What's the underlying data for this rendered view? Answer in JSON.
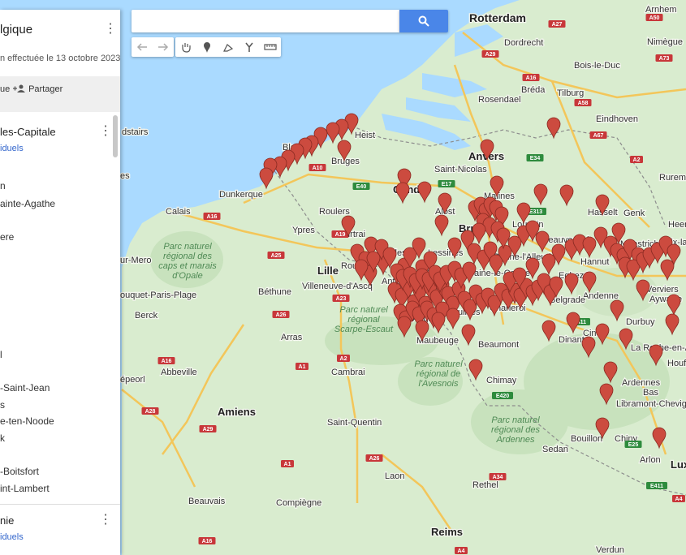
{
  "map": {
    "sea_color": "#aadaff",
    "land_color": "#d7ecd0",
    "pin_color": "#cc4b3f",
    "cities": [
      {
        "id": "rotterdam",
        "label": "Rotterdam",
        "cls": "big"
      },
      {
        "id": "arnhem",
        "label": "Arnhem",
        "cls": ""
      },
      {
        "id": "dordrecht",
        "label": "Dordrecht",
        "cls": ""
      },
      {
        "id": "nimegue",
        "label": "Nimègue",
        "cls": ""
      },
      {
        "id": "boisleduc",
        "label": "Bois-le-Duc",
        "cls": ""
      },
      {
        "id": "breda",
        "label": "Bréda",
        "cls": ""
      },
      {
        "id": "tilburg",
        "label": "Tilburg",
        "cls": ""
      },
      {
        "id": "rosendael",
        "label": "Rosendael",
        "cls": ""
      },
      {
        "id": "eindhoven",
        "label": "Eindhoven",
        "cls": ""
      },
      {
        "id": "heist",
        "label": "Heist",
        "cls": ""
      },
      {
        "id": "blank",
        "label": "Blank",
        "cls": ""
      },
      {
        "id": "bruges",
        "label": "Bruges",
        "cls": ""
      },
      {
        "id": "anvers",
        "label": "Anvers",
        "cls": "med"
      },
      {
        "id": "saintnicolas",
        "label": "Saint-Nicolas",
        "cls": ""
      },
      {
        "id": "gand",
        "label": "Gand",
        "cls": "med"
      },
      {
        "id": "malines",
        "label": "Malines",
        "cls": ""
      },
      {
        "id": "dunkerque",
        "label": "Dunkerque",
        "cls": ""
      },
      {
        "id": "roulers",
        "label": "Roulers",
        "cls": ""
      },
      {
        "id": "hasselt",
        "label": "Hasselt",
        "cls": ""
      },
      {
        "id": "genk",
        "label": "Genk",
        "cls": ""
      },
      {
        "id": "ruremonde",
        "label": "Ruremonde",
        "cls": ""
      },
      {
        "id": "calais",
        "label": "Calais",
        "cls": ""
      },
      {
        "id": "alost",
        "label": "Alost",
        "cls": ""
      },
      {
        "id": "bruxelles",
        "label": "Bru",
        "cls": "med"
      },
      {
        "id": "louvain",
        "label": "Louvain",
        "cls": ""
      },
      {
        "id": "heerlen",
        "label": "Heerl",
        "cls": ""
      },
      {
        "id": "ypres",
        "label": "Ypres",
        "cls": ""
      },
      {
        "id": "courtrai",
        "label": "Courtrai",
        "cls": ""
      },
      {
        "id": "beauvechain",
        "label": "Beauvechain",
        "cls": ""
      },
      {
        "id": "maastricht",
        "label": "Maastricht",
        "cls": ""
      },
      {
        "id": "aixla",
        "label": "Aix-la",
        "cls": ""
      },
      {
        "id": "celles",
        "label": "Celles",
        "cls": ""
      },
      {
        "id": "lessines",
        "label": "Lessines",
        "cls": ""
      },
      {
        "id": "brainealleud",
        "label": "Braine-l'Alleud",
        "cls": ""
      },
      {
        "id": "hannut",
        "label": "Hannut",
        "cls": ""
      },
      {
        "id": "lille",
        "label": "Lille",
        "cls": "med"
      },
      {
        "id": "roubaix",
        "label": "Roub",
        "cls": ""
      },
      {
        "id": "egheze",
        "label": "Eghezée",
        "cls": ""
      },
      {
        "id": "antoing",
        "label": "Antoing",
        "cls": ""
      },
      {
        "id": "arbre",
        "label": "Arbre",
        "cls": ""
      },
      {
        "id": "brainelecomte",
        "label": "Braine-le-Comte",
        "cls": ""
      },
      {
        "id": "villeneuve",
        "label": "Villeneuve-d'Ascq",
        "cls": ""
      },
      {
        "id": "bethune",
        "label": "Béthune",
        "cls": ""
      },
      {
        "id": "andenne",
        "label": "Andenne",
        "cls": ""
      },
      {
        "id": "verviers",
        "label": "Verviers",
        "cls": ""
      },
      {
        "id": "aywaille",
        "label": "Aywaille",
        "cls": ""
      },
      {
        "id": "belgrade",
        "label": "Belgrade",
        "cls": ""
      },
      {
        "id": "asquillies",
        "label": "Asquillies",
        "cls": ""
      },
      {
        "id": "charleroi",
        "label": "Charleroi",
        "cls": ""
      },
      {
        "id": "berck",
        "label": "Berck",
        "cls": ""
      },
      {
        "id": "arras",
        "label": "Arras",
        "cls": ""
      },
      {
        "id": "angre",
        "label": "Angre",
        "cls": ""
      },
      {
        "id": "durbuy",
        "label": "Durbuy",
        "cls": ""
      },
      {
        "id": "maubeuge",
        "label": "Maubeuge",
        "cls": ""
      },
      {
        "id": "beaumont",
        "label": "Beaumont",
        "cls": ""
      },
      {
        "id": "ciney",
        "label": "Ciney",
        "cls": ""
      },
      {
        "id": "dinant",
        "label": "Dinant",
        "cls": ""
      },
      {
        "id": "laroche",
        "label": "La Roche-en-Ardenne",
        "cls": ""
      },
      {
        "id": "houff",
        "label": "Houff",
        "cls": ""
      },
      {
        "id": "abbeville",
        "label": "Abbeville",
        "cls": ""
      },
      {
        "id": "cambrai",
        "label": "Cambrai",
        "cls": ""
      },
      {
        "id": "chimay",
        "label": "Chimay",
        "cls": ""
      },
      {
        "id": "ardennes",
        "label": "Ardennes",
        "cls": ""
      },
      {
        "id": "bastogne",
        "label": "Bas",
        "cls": ""
      },
      {
        "id": "libramont",
        "label": "Libramont-Chevigny",
        "cls": ""
      },
      {
        "id": "amiens",
        "label": "Amiens",
        "cls": "med"
      },
      {
        "id": "saintquentin",
        "label": "Saint-Quentin",
        "cls": ""
      },
      {
        "id": "bouillon",
        "label": "Bouillon",
        "cls": ""
      },
      {
        "id": "chiny",
        "label": "Chiny",
        "cls": ""
      },
      {
        "id": "sedan",
        "label": "Sedan",
        "cls": ""
      },
      {
        "id": "arlon",
        "label": "Arlon",
        "cls": ""
      },
      {
        "id": "lux",
        "label": "Lux",
        "cls": "med"
      },
      {
        "id": "laon",
        "label": "Laon",
        "cls": ""
      },
      {
        "id": "rethel",
        "label": "Rethel",
        "cls": ""
      },
      {
        "id": "beauvais",
        "label": "Beauvais",
        "cls": ""
      },
      {
        "id": "compiegne",
        "label": "Compiègne",
        "cls": ""
      },
      {
        "id": "reims",
        "label": "Reims",
        "cls": "med"
      },
      {
        "id": "verdun",
        "label": "Verdun",
        "cls": ""
      },
      {
        "id": "smero",
        "label": "ur-Mero",
        "cls": ""
      },
      {
        "id": "montreuil",
        "label": "ouquet-Paris-Plage",
        "cls": ""
      },
      {
        "id": "epeorn",
        "label": "épeorl",
        "cls": ""
      },
      {
        "id": "ads",
        "label": "dstairs",
        "cls": ""
      },
      {
        "id": "es",
        "label": "es",
        "cls": ""
      }
    ],
    "parks": [
      {
        "id": "park-opale",
        "lines": [
          "Parc naturel",
          "régional des",
          "caps et marais",
          "d'Opale"
        ]
      },
      {
        "id": "park-scarpe",
        "lines": [
          "Parc naturel",
          "régional",
          "Scarpe-Escaut"
        ]
      },
      {
        "id": "park-avesnois",
        "lines": [
          "Parc naturel",
          "régional de",
          "l'Avesnois"
        ]
      },
      {
        "id": "park-ardennes",
        "lines": [
          "Parc naturel",
          "régional des",
          "Ardennes"
        ]
      }
    ],
    "roads": [
      {
        "id": "a27",
        "label": "A27"
      },
      {
        "id": "a29",
        "label": "A29"
      },
      {
        "id": "a16nl",
        "label": "A16"
      },
      {
        "id": "a58",
        "label": "A58"
      },
      {
        "id": "a73",
        "label": "A73"
      },
      {
        "id": "a50",
        "label": "A50"
      },
      {
        "id": "a67",
        "label": "A67"
      },
      {
        "id": "a2",
        "label": "A2"
      },
      {
        "id": "a10",
        "label": "A10"
      },
      {
        "id": "e40",
        "label": "E40"
      },
      {
        "id": "e17",
        "label": "E17"
      },
      {
        "id": "e34",
        "label": "E34"
      },
      {
        "id": "e313",
        "label": "E313"
      },
      {
        "id": "a16fr",
        "label": "A16"
      },
      {
        "id": "a19",
        "label": "A19"
      },
      {
        "id": "a25",
        "label": "A25"
      },
      {
        "id": "a23",
        "label": "A23"
      },
      {
        "id": "a26",
        "label": "A26"
      },
      {
        "id": "a1",
        "label": "A1"
      },
      {
        "id": "a2fr",
        "label": "A2"
      },
      {
        "id": "a16b",
        "label": "A16"
      },
      {
        "id": "a28",
        "label": "A28"
      },
      {
        "id": "a29fr",
        "label": "A29"
      },
      {
        "id": "e411",
        "label": "E411"
      },
      {
        "id": "e420",
        "label": "E420"
      },
      {
        "id": "e25",
        "label": "E25"
      },
      {
        "id": "a34",
        "label": "A34"
      },
      {
        "id": "a26b",
        "label": "A26"
      },
      {
        "id": "a1b",
        "label": "A1"
      },
      {
        "id": "a16c",
        "label": "A16"
      },
      {
        "id": "a4",
        "label": "A4"
      },
      {
        "id": "e411b",
        "label": "E411"
      },
      {
        "id": "a4b",
        "label": "A4"
      }
    ]
  },
  "search": {
    "placeholder": ""
  },
  "panel": {
    "title": "lgique",
    "subtitle": "n effectuée le 13 octobre 2023",
    "action_1": "ue",
    "action_2": "Partager",
    "layers": [
      {
        "title": "les-Capitale",
        "sub": "iduels",
        "items": [
          "n",
          "ainte-Agathe",
          "ere",
          "",
          "",
          "",
          "",
          "l",
          "-Saint-Jean",
          "s",
          "e-ten-Noode",
          "k",
          "-Boitsfort",
          "int-Lambert"
        ]
      },
      {
        "title": "nie",
        "sub": "iduels",
        "items": []
      }
    ]
  }
}
